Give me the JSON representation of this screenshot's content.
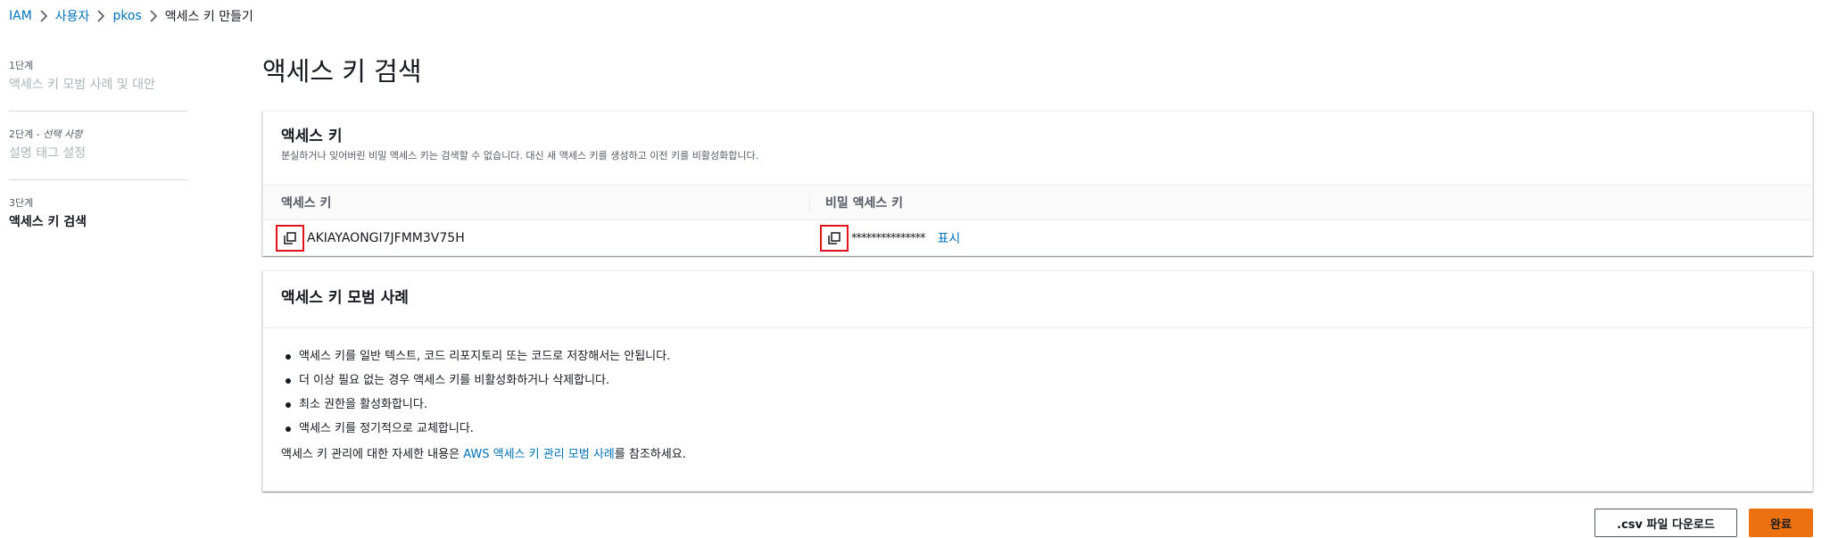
{
  "breadcrumb": {
    "items": [
      "IAM",
      "사용자",
      "pkos"
    ],
    "current": "액세스 키 만들기"
  },
  "steps": [
    {
      "num": "1단계",
      "title": "액세스 키 모범 사례 및 대안"
    },
    {
      "num": "2단계",
      "optional": "선택 사항",
      "title": "설명 태그 설정"
    },
    {
      "num": "3단계",
      "title": "액세스 키 검색"
    }
  ],
  "page_title": "액세스 키 검색",
  "keys_panel": {
    "title": "액세스 키",
    "description": "분실하거나 잊어버린 비밀 액세스 키는 검색할 수 없습니다. 대신 새 액세스 키를 생성하고 이전 키를 비활성화합니다.",
    "col_access_key": "액세스 키",
    "col_secret_key": "비밀 액세스 키",
    "access_key_value": "AKIAYAONGI7JFMM3V75H",
    "secret_key_masked": "***************",
    "show_label": "표시"
  },
  "best_panel": {
    "title": "액세스 키 모범 사례",
    "items": [
      "액세스 키를 일반 텍스트, 코드 리포지토리 또는 코드로 저장해서는 안됩니다.",
      "더 이상 필요 없는 경우 액세스 키를 비활성화하거나 삭제합니다.",
      "최소 권한을 활성화합니다.",
      "액세스 키를 정기적으로 교체합니다."
    ],
    "footer_prefix": "액세스 키 관리에 대한 자세한 내용은 ",
    "footer_link": "AWS 액세스 키 관리 모범 사례",
    "footer_suffix": "를 참조하세요."
  },
  "buttons": {
    "csv": ".csv 파일 다운로드",
    "done": "완료"
  },
  "colors": {
    "link": "#0073bb",
    "primary": "#ec7211",
    "highlight": "#e0141a"
  }
}
